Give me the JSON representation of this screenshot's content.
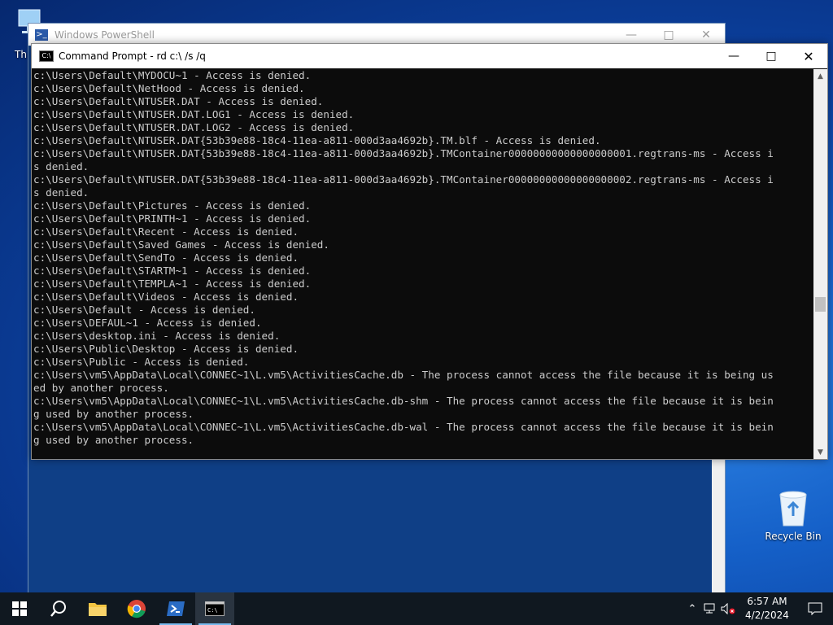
{
  "desktop": {
    "recycle_bin_label": "Recycle Bin",
    "this_pc_label": "Th"
  },
  "powershell": {
    "title": "Windows PowerShell"
  },
  "cmd": {
    "title": "Command Prompt - rd  c:\\ /s /q",
    "lines": [
      "c:\\Users\\Default\\MYDOCU~1 - Access is denied.",
      "c:\\Users\\Default\\NetHood - Access is denied.",
      "c:\\Users\\Default\\NTUSER.DAT - Access is denied.",
      "c:\\Users\\Default\\NTUSER.DAT.LOG1 - Access is denied.",
      "c:\\Users\\Default\\NTUSER.DAT.LOG2 - Access is denied.",
      "c:\\Users\\Default\\NTUSER.DAT{53b39e88-18c4-11ea-a811-000d3aa4692b}.TM.blf - Access is denied.",
      "c:\\Users\\Default\\NTUSER.DAT{53b39e88-18c4-11ea-a811-000d3aa4692b}.TMContainer00000000000000000001.regtrans-ms - Access i",
      "s denied.",
      "c:\\Users\\Default\\NTUSER.DAT{53b39e88-18c4-11ea-a811-000d3aa4692b}.TMContainer00000000000000000002.regtrans-ms - Access i",
      "s denied.",
      "c:\\Users\\Default\\Pictures - Access is denied.",
      "c:\\Users\\Default\\PRINTH~1 - Access is denied.",
      "c:\\Users\\Default\\Recent - Access is denied.",
      "c:\\Users\\Default\\Saved Games - Access is denied.",
      "c:\\Users\\Default\\SendTo - Access is denied.",
      "c:\\Users\\Default\\STARTM~1 - Access is denied.",
      "c:\\Users\\Default\\TEMPLA~1 - Access is denied.",
      "c:\\Users\\Default\\Videos - Access is denied.",
      "c:\\Users\\Default - Access is denied.",
      "c:\\Users\\DEFAUL~1 - Access is denied.",
      "c:\\Users\\desktop.ini - Access is denied.",
      "c:\\Users\\Public\\Desktop - Access is denied.",
      "c:\\Users\\Public - Access is denied.",
      "c:\\Users\\vm5\\AppData\\Local\\CONNEC~1\\L.vm5\\ActivitiesCache.db - The process cannot access the file because it is being us",
      "ed by another process.",
      "c:\\Users\\vm5\\AppData\\Local\\CONNEC~1\\L.vm5\\ActivitiesCache.db-shm - The process cannot access the file because it is bein",
      "g used by another process.",
      "c:\\Users\\vm5\\AppData\\Local\\CONNEC~1\\L.vm5\\ActivitiesCache.db-wal - The process cannot access the file because it is bein",
      "g used by another process."
    ]
  },
  "taskbar": {
    "time": "6:57 AM",
    "date": "4/2/2024"
  },
  "colors": {
    "terminal_bg": "#0c0c0c",
    "terminal_fg": "#cccccc",
    "taskbar_bg": "#101820",
    "powershell_blue": "#1b4f96"
  }
}
